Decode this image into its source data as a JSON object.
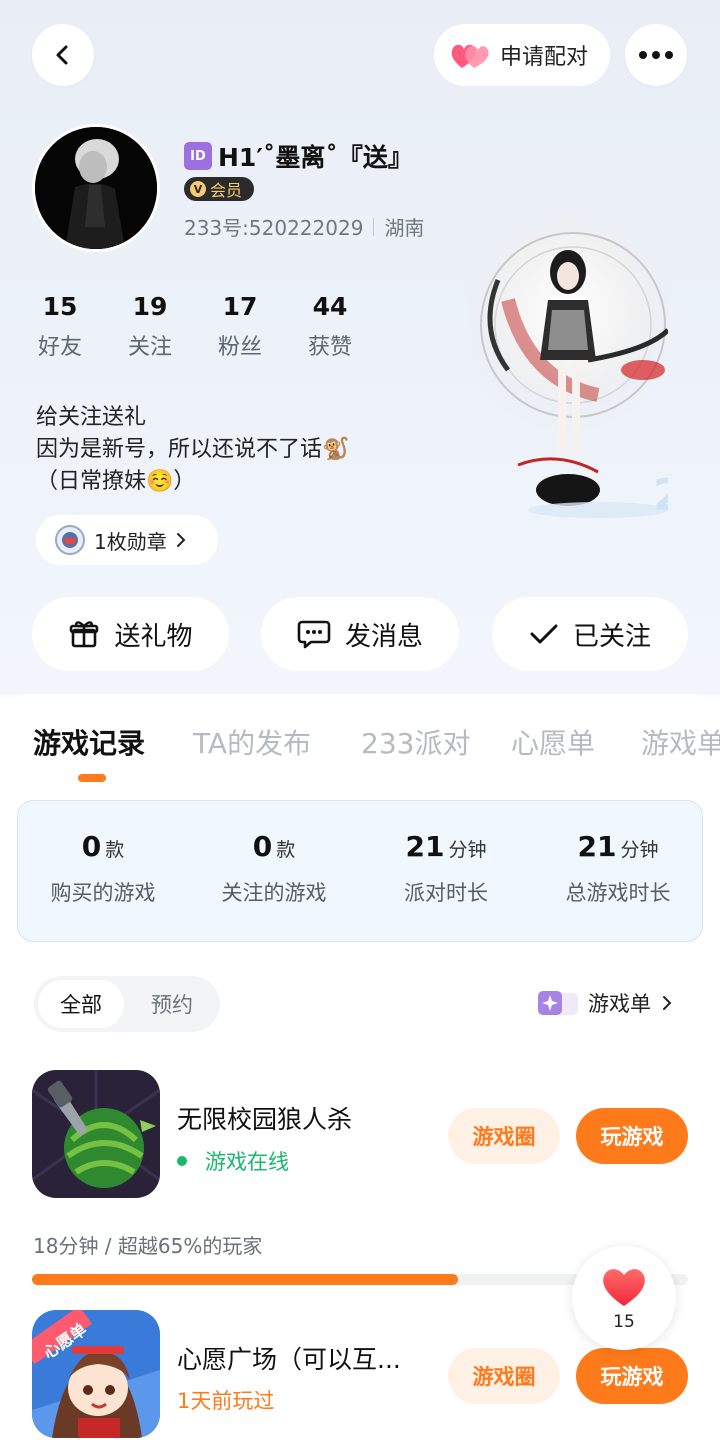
{
  "header": {
    "pair_label": "申请配对"
  },
  "profile": {
    "id_badge": "ID",
    "name": "H1′˚墨离˚『送』",
    "vip_label": "会员",
    "vip_letter": "V",
    "account_id": "233号:520222029",
    "location": "湖南",
    "stats": [
      {
        "value": "15",
        "label": "好友"
      },
      {
        "value": "19",
        "label": "关注"
      },
      {
        "value": "17",
        "label": "粉丝"
      },
      {
        "value": "44",
        "label": "获赞"
      }
    ],
    "bio_lines": [
      "给关注送礼",
      "因为是新号，所以还说不了话🐒",
      "（日常撩妹☺️）"
    ],
    "medal_label": "1枚勋章"
  },
  "actions": {
    "gift": "送礼物",
    "message": "发消息",
    "follow": "已关注"
  },
  "tabs": [
    {
      "label": "游戏记录",
      "active": true
    },
    {
      "label": "TA的发布",
      "active": false
    },
    {
      "label": "233派对",
      "active": false
    },
    {
      "label": "心愿单",
      "active": false
    },
    {
      "label": "游戏单",
      "active": false
    }
  ],
  "summary": [
    {
      "value": "0",
      "unit": "款",
      "label": "购买的游戏"
    },
    {
      "value": "0",
      "unit": "款",
      "label": "关注的游戏"
    },
    {
      "value": "21",
      "unit": "分钟",
      "label": "派对时长"
    },
    {
      "value": "21",
      "unit": "分钟",
      "label": "总游戏时长"
    }
  ],
  "filter": {
    "all": "全部",
    "reserve": "预约",
    "gamelist_link": "游戏单"
  },
  "games": [
    {
      "title": "无限校园狼人杀",
      "status": "游戏在线",
      "status_color": "#19b86b",
      "circle_btn": "游戏圈",
      "play_btn": "玩游戏",
      "progress_text": "18分钟 / 超越65%的玩家",
      "progress_fraction": 0.65
    },
    {
      "title": "心愿广场（可以互...",
      "status": "1天前玩过",
      "status_color": "#ff7a1a",
      "circle_btn": "游戏圈",
      "play_btn": "玩游戏",
      "icon_banner": "心愿单"
    }
  ],
  "like_float": {
    "count": "15"
  },
  "colors": {
    "accent": "#ff7a1a",
    "vip_gold": "#f6cb72"
  }
}
